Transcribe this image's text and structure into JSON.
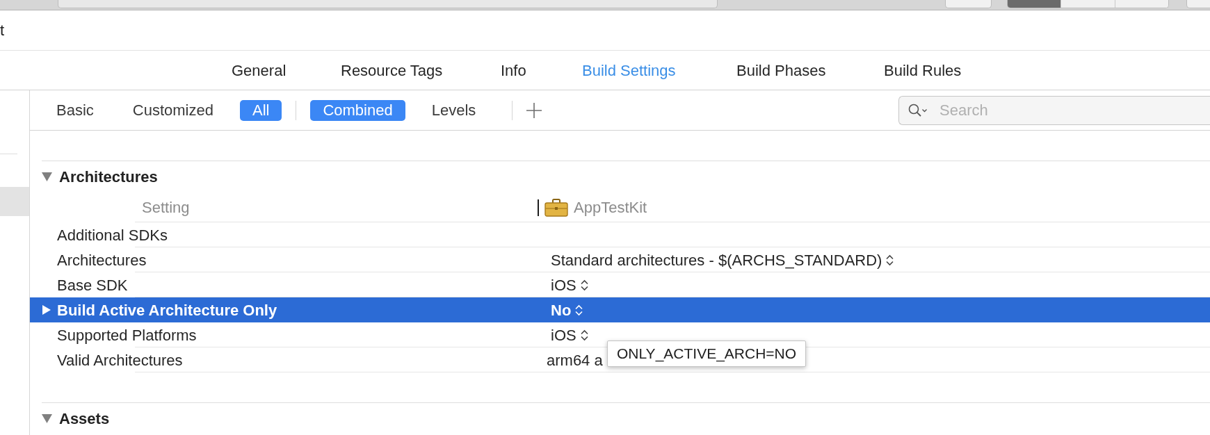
{
  "toolbar": {
    "segments": [
      {
        "selected": true
      },
      {
        "selected": false
      },
      {
        "selected": false
      }
    ]
  },
  "window": {
    "title": "t"
  },
  "tabs": [
    {
      "label": "General",
      "selected": false
    },
    {
      "label": "Resource Tags",
      "selected": false
    },
    {
      "label": "Info",
      "selected": false
    },
    {
      "label": "Build Settings",
      "selected": true
    },
    {
      "label": "Build Phases",
      "selected": false
    },
    {
      "label": "Build Rules",
      "selected": false
    }
  ],
  "filter_bar": {
    "scopes": [
      {
        "label": "Basic",
        "selected": false
      },
      {
        "label": "Customized",
        "selected": false
      },
      {
        "label": "All",
        "selected": true
      }
    ],
    "views": [
      {
        "label": "Combined",
        "selected": true
      },
      {
        "label": "Levels",
        "selected": false
      }
    ],
    "search": {
      "placeholder": "Search"
    }
  },
  "sections": [
    {
      "title": "Architectures",
      "expanded": true,
      "columns": [
        {
          "label": "Setting"
        },
        {
          "label": "AppTestKit"
        }
      ],
      "rows": [
        {
          "name": "Additional SDKs",
          "kind": "text",
          "selected": false
        },
        {
          "name": "Architectures",
          "kind": "popup",
          "value": "Standard architectures - $(ARCHS_STANDARD)",
          "selected": false
        },
        {
          "name": "Base SDK",
          "kind": "popup",
          "value": "iOS",
          "selected": false
        },
        {
          "name": "Build Active Architecture Only",
          "kind": "popup",
          "value": "No",
          "selected": true
        },
        {
          "name": "Supported Platforms",
          "kind": "popup",
          "value": "iOS",
          "selected": false
        },
        {
          "name": "Valid Architectures",
          "kind": "text",
          "value": "arm64 a",
          "selected": false
        }
      ]
    },
    {
      "title": "Assets",
      "expanded": true
    }
  ],
  "tooltip": {
    "text": "ONLY_ACTIVE_ARCH=NO"
  }
}
